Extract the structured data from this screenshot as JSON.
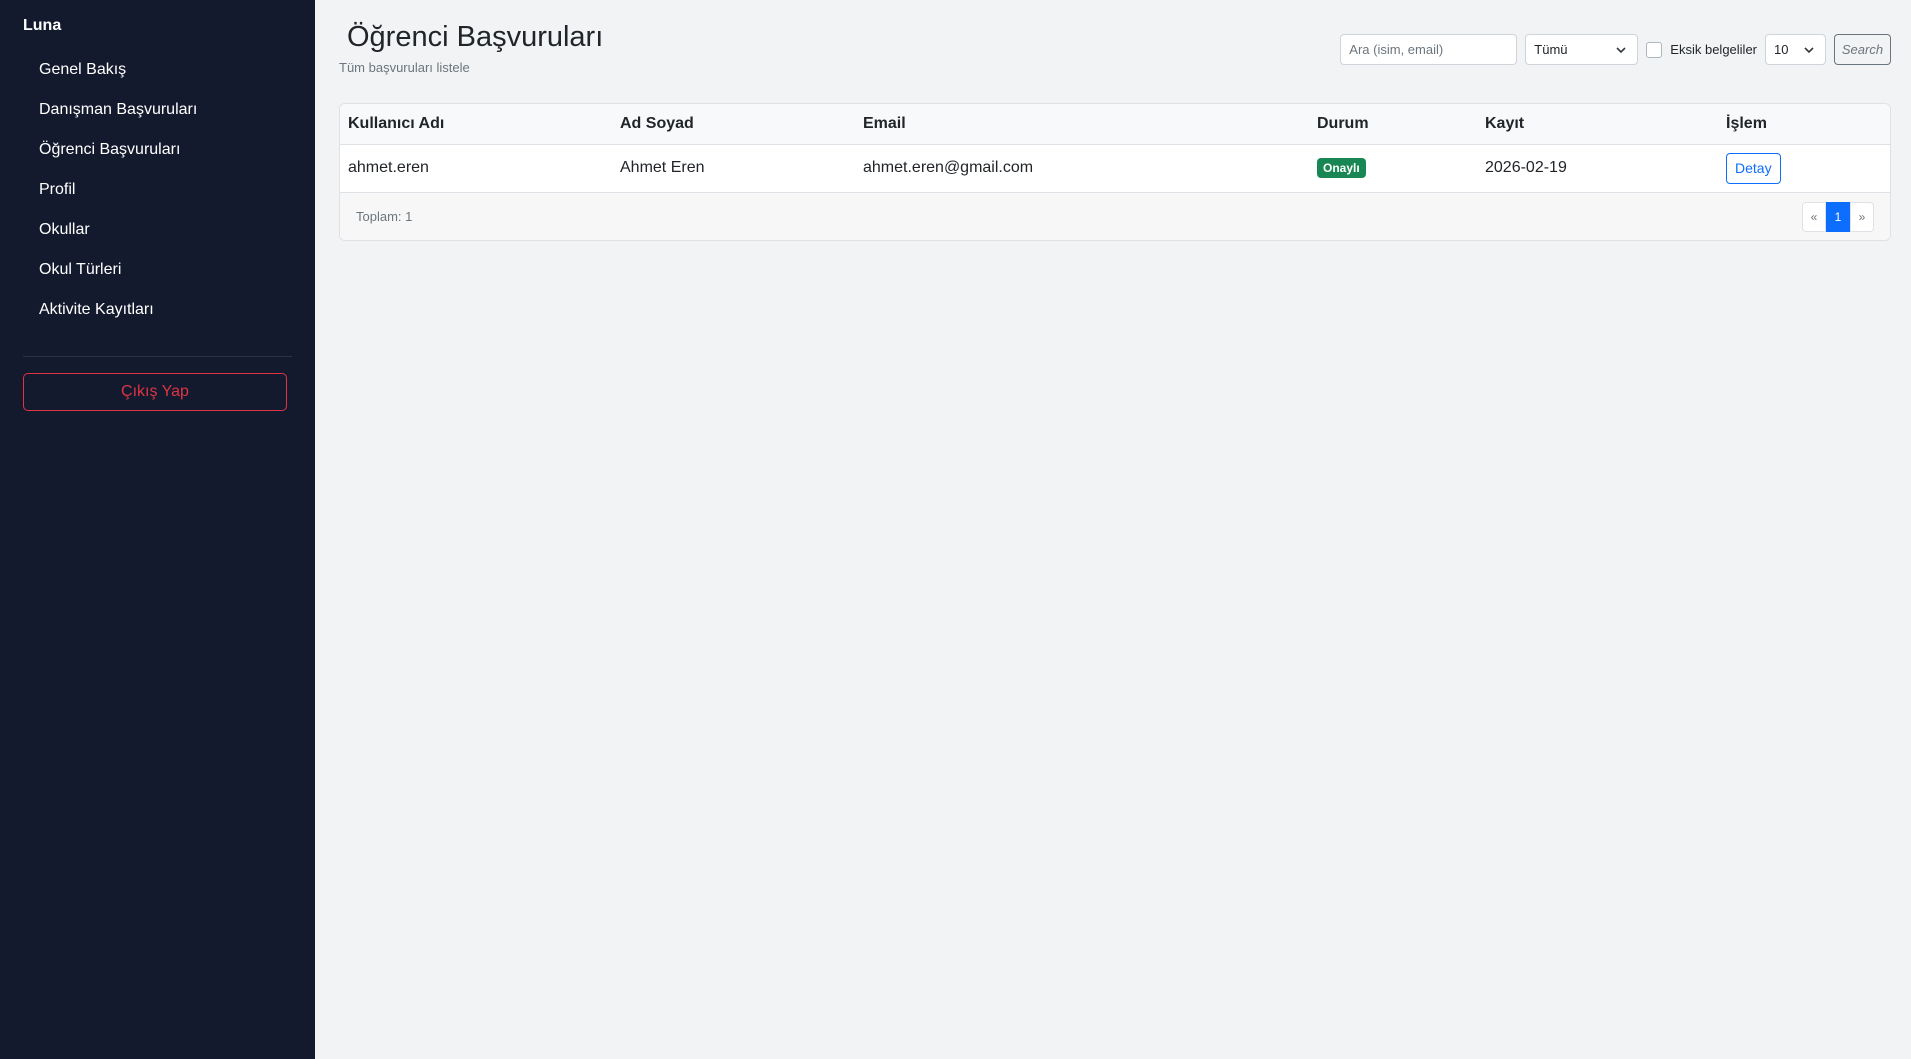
{
  "sidebar": {
    "brand": "Luna",
    "items": [
      {
        "label": "Genel Bakış"
      },
      {
        "label": "Danışman Başvuruları"
      },
      {
        "label": "Öğrenci Başvuruları"
      },
      {
        "label": "Profil"
      },
      {
        "label": "Okullar"
      },
      {
        "label": "Okul Türleri"
      },
      {
        "label": "Aktivite Kayıtları"
      }
    ],
    "logout_label": "Çıkış Yap"
  },
  "header": {
    "title": "Öğrenci Başvuruları",
    "subtitle": "Tüm başvuruları listele"
  },
  "filters": {
    "search_placeholder": "Ara (isim, email)",
    "status_value": "Tümü",
    "missing_docs_label": "Eksik belgeliler",
    "page_size_value": "10",
    "search_button": "Search"
  },
  "table": {
    "columns": [
      "Kullanıcı Adı",
      "Ad Soyad",
      "Email",
      "Durum",
      "Kayıt",
      "İşlem"
    ],
    "rows": [
      {
        "username": "ahmet.eren",
        "fullname": "Ahmet Eren",
        "email": "ahmet.eren@gmail.com",
        "status": "Onaylı",
        "date": "2026-02-19",
        "action": "Detay"
      }
    ]
  },
  "footer": {
    "total": "Toplam: 1",
    "pager": {
      "prev": "«",
      "current": "1",
      "next": "»"
    }
  },
  "colors": {
    "sidebar_bg": "#131a2d",
    "danger": "#dc3545",
    "success": "#198754",
    "primary": "#0d6efd"
  }
}
